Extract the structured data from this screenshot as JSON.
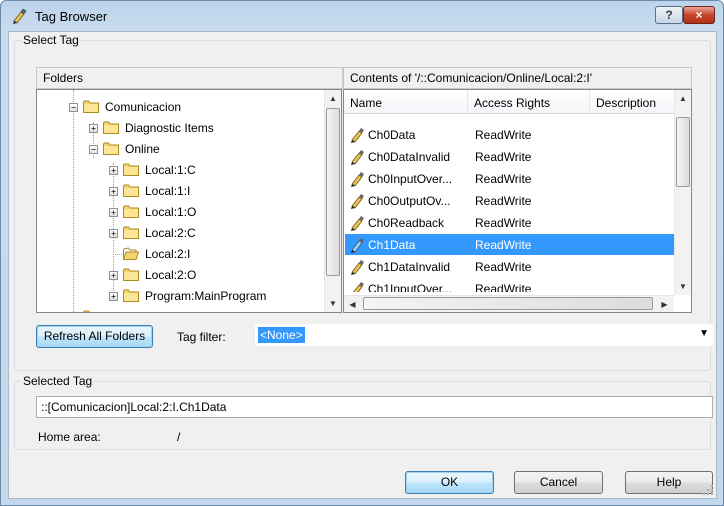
{
  "window": {
    "title": "Tag Browser",
    "help_button": "?",
    "close_button": "×"
  },
  "select_tag": {
    "group_label": "Select Tag",
    "folders_header": "Folders",
    "contents_header": "Contents of '/::Comunicacion/Online/Local:2:I'",
    "tree": [
      {
        "label": "Comunicacion",
        "expander": "−"
      },
      {
        "label": "Diagnostic Items",
        "expander": "+"
      },
      {
        "label": "Online",
        "expander": "−"
      },
      {
        "label": "Local:1:C",
        "expander": "+"
      },
      {
        "label": "Local:1:I",
        "expander": "+"
      },
      {
        "label": "Local:1:O",
        "expander": "+"
      },
      {
        "label": "Local:2:C",
        "expander": "+"
      },
      {
        "label": "Local:2:I",
        "expander": ""
      },
      {
        "label": "Local:2:O",
        "expander": "+"
      },
      {
        "label": "Program:MainProgram",
        "expander": "+"
      }
    ],
    "columns": [
      "Name",
      "Access Rights",
      "Description"
    ],
    "rows": [
      {
        "name": "Ch0Data",
        "access": "ReadWrite",
        "description": "",
        "selected": false
      },
      {
        "name": "Ch0DataInvalid",
        "access": "ReadWrite",
        "description": "",
        "selected": false
      },
      {
        "name": "Ch0InputOver...",
        "access": "ReadWrite",
        "description": "",
        "selected": false
      },
      {
        "name": "Ch0OutputOv...",
        "access": "ReadWrite",
        "description": "",
        "selected": false
      },
      {
        "name": "Ch0Readback",
        "access": "ReadWrite",
        "description": "",
        "selected": false
      },
      {
        "name": "Ch1Data",
        "access": "ReadWrite",
        "description": "",
        "selected": true
      },
      {
        "name": "Ch1DataInvalid",
        "access": "ReadWrite",
        "description": "",
        "selected": false
      },
      {
        "name": "Ch1InputOver...",
        "access": "ReadWrite",
        "description": "",
        "selected": false
      }
    ],
    "refresh_button": "Refresh All Folders",
    "tag_filter_label": "Tag filter:",
    "tag_filter_value": "<None>"
  },
  "selected_tag": {
    "group_label": "Selected Tag",
    "value": "::[Comunicacion]Local:2:I.Ch1Data",
    "home_area_label": "Home area:",
    "home_area_value": "/"
  },
  "buttons": {
    "ok": "OK",
    "cancel": "Cancel",
    "help": "Help"
  },
  "icons": {
    "title": "tag-pencil-icon",
    "folder": "folder-icon",
    "tag": "tag-pencil-icon"
  },
  "colors": {
    "selection": "#3399ff",
    "title_bar": "#c5d9ee",
    "close_button": "#c7442b"
  }
}
